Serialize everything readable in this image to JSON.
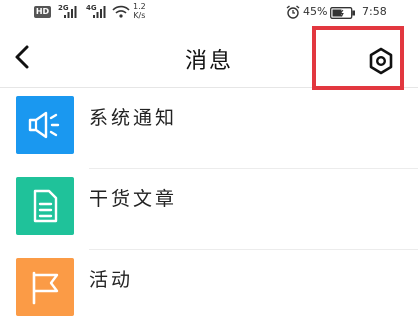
{
  "status_bar": {
    "hd": "HD",
    "signal1": "2G",
    "signal2": "4G",
    "speed_value": "1.2",
    "speed_unit": "K/s",
    "battery_pct": "45%",
    "time": "7:58"
  },
  "header": {
    "title": "消息",
    "back_icon": "chevron-left-icon",
    "settings_icon": "settings-hexagon-icon"
  },
  "highlight_color": "#e2373f",
  "list": [
    {
      "label": "系统通知",
      "icon": "megaphone-icon",
      "color": "#1a98f0"
    },
    {
      "label": "干货文章",
      "icon": "document-icon",
      "color": "#1fc29a"
    },
    {
      "label": "活动",
      "icon": "flag-icon",
      "color": "#fb9b46"
    }
  ]
}
